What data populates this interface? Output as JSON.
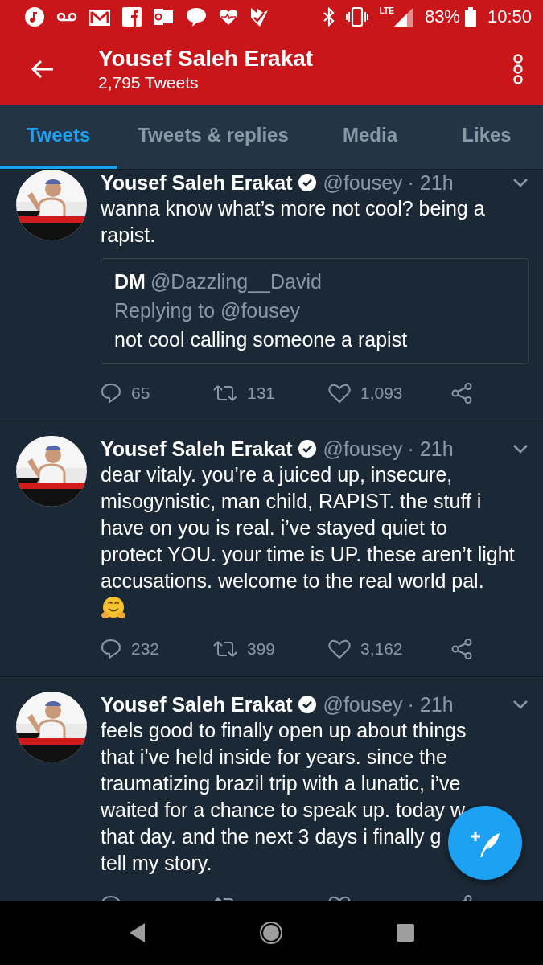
{
  "status_bar": {
    "network": "LTE",
    "battery": "83%",
    "time": "10:50"
  },
  "header": {
    "title": "Yousef Saleh Erakat",
    "subtitle": "2,795 Tweets"
  },
  "tabs": [
    {
      "label": "Tweets",
      "selected": true
    },
    {
      "label": "Tweets & replies",
      "selected": false
    },
    {
      "label": "Media",
      "selected": false
    },
    {
      "label": "Likes",
      "selected": false
    }
  ],
  "tweets": [
    {
      "name": "Yousef Saleh Erakat",
      "verified": true,
      "handle": "@fousey",
      "time": "· 21h",
      "lines": [
        "wanna know what’s more not cool? being a",
        "rapist."
      ],
      "quote": {
        "name": "DM",
        "handle": "@Dazzling__David",
        "replying": "Replying to @fousey",
        "text": "not cool calling someone a rapist"
      },
      "replies": "65",
      "retweets": "131",
      "likes": "1,093"
    },
    {
      "name": "Yousef Saleh Erakat",
      "verified": true,
      "handle": "@fousey",
      "time": "· 21h",
      "lines": [
        "dear vitaly. you’re a juiced up, insecure,",
        "misogynistic, man child, RAPIST. the stuff i",
        "have on you is real. i’ve stayed quiet to",
        "protect YOU. your time is UP. these aren’t light",
        "accusations. welcome to the real world pal."
      ],
      "hug_emoji": true,
      "replies": "232",
      "retweets": "399",
      "likes": "3,162"
    },
    {
      "name": "Yousef Saleh Erakat",
      "verified": true,
      "handle": "@fousey",
      "time": "· 21h",
      "lines": [
        "feels good to finally open up about things",
        "that i’ve held inside for years. since the",
        "traumatizing brazil trip with a lunatic, i’ve",
        "waited for a chance to speak up. today w",
        "that day. and the next 3 days i finally g",
        "tell my story."
      ]
    }
  ]
}
